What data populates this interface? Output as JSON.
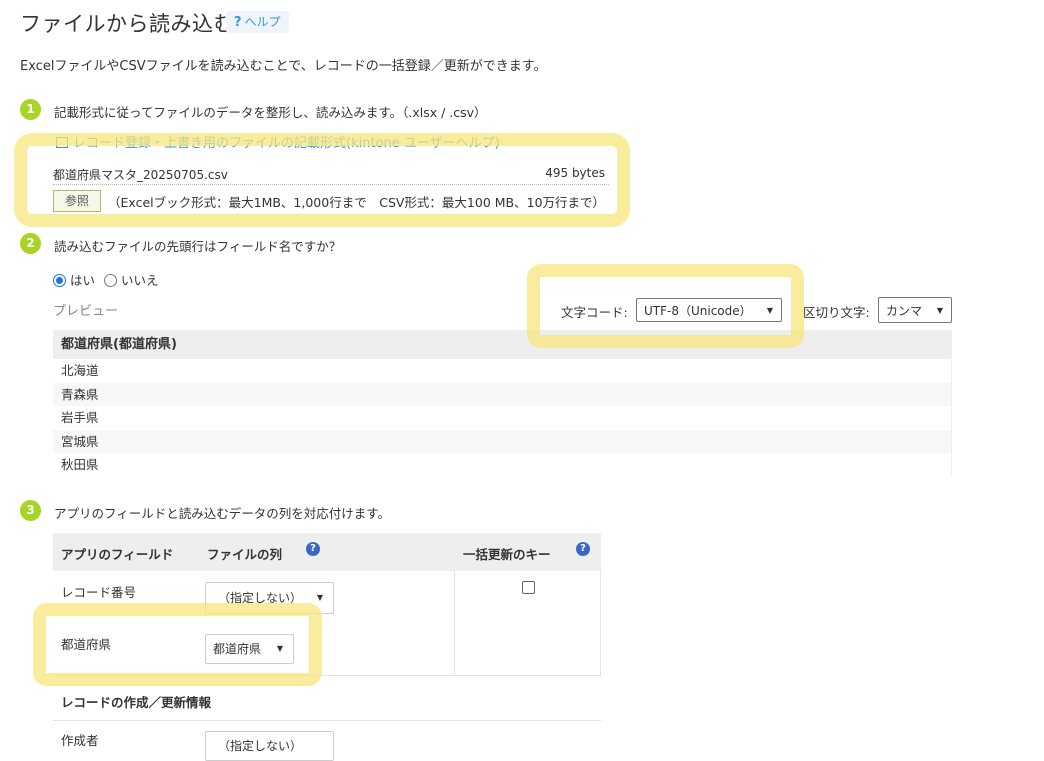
{
  "header": {
    "title": "ファイルから読み込む",
    "help_icon": "?",
    "help_label": "ヘルプ"
  },
  "description": "ExcelファイルやCSVファイルを読み込むことで、レコードの一括登録／更新ができます。",
  "step1": {
    "number": "1",
    "text": "記載形式に従ってファイルのデータを整形し、読み込みます。（.xlsx / .csv）",
    "link_label": "レコード登録・上書き用のファイルの記載形式(kintone ユーザーヘルプ)",
    "link_icon": "external-window-icon",
    "file_name": "都道府県マスタ_20250705.csv",
    "file_size": "495 bytes",
    "browse_label": "参照",
    "limits": "（Excelブック形式：最大1MB、1,000行まで　CSV形式：最大100 MB、10万行まで）"
  },
  "step2": {
    "number": "2",
    "text": "読み込むファイルの先頭行はフィールド名ですか？",
    "option_yes": "はい",
    "option_no": "いいえ",
    "selected": "はい",
    "preview_label": "プレビュー",
    "encoding_label": "文字コード:",
    "encoding_value": "UTF-8（Unicode）",
    "delimiter_label": "区切り文字:",
    "delimiter_value": "カンマ",
    "preview_header": "都道府県(都道府県)",
    "preview_rows": [
      "北海道",
      "青森県",
      "岩手県",
      "宮城県",
      "秋田県"
    ]
  },
  "step3": {
    "number": "3",
    "text": "アプリのフィールドと読み込むデータの列を対応付けます。",
    "col_app_field": "アプリのフィールド",
    "col_file_column": "ファイルの列",
    "col_bulk_key": "一括更新のキー",
    "help_icon": "?",
    "rows": [
      {
        "field": "レコード番号",
        "select": "（指定しない）"
      },
      {
        "field": "都道府県",
        "select": "都道府県"
      }
    ],
    "section_title": "レコードの作成／更新情報",
    "section_rows": [
      {
        "field": "作成者",
        "select": "（指定しない）"
      }
    ]
  },
  "colors": {
    "accent": "#3498db",
    "step_badge": "#a8d423",
    "highlight": "#f7e57c",
    "help_icon": "#3a67c7"
  }
}
